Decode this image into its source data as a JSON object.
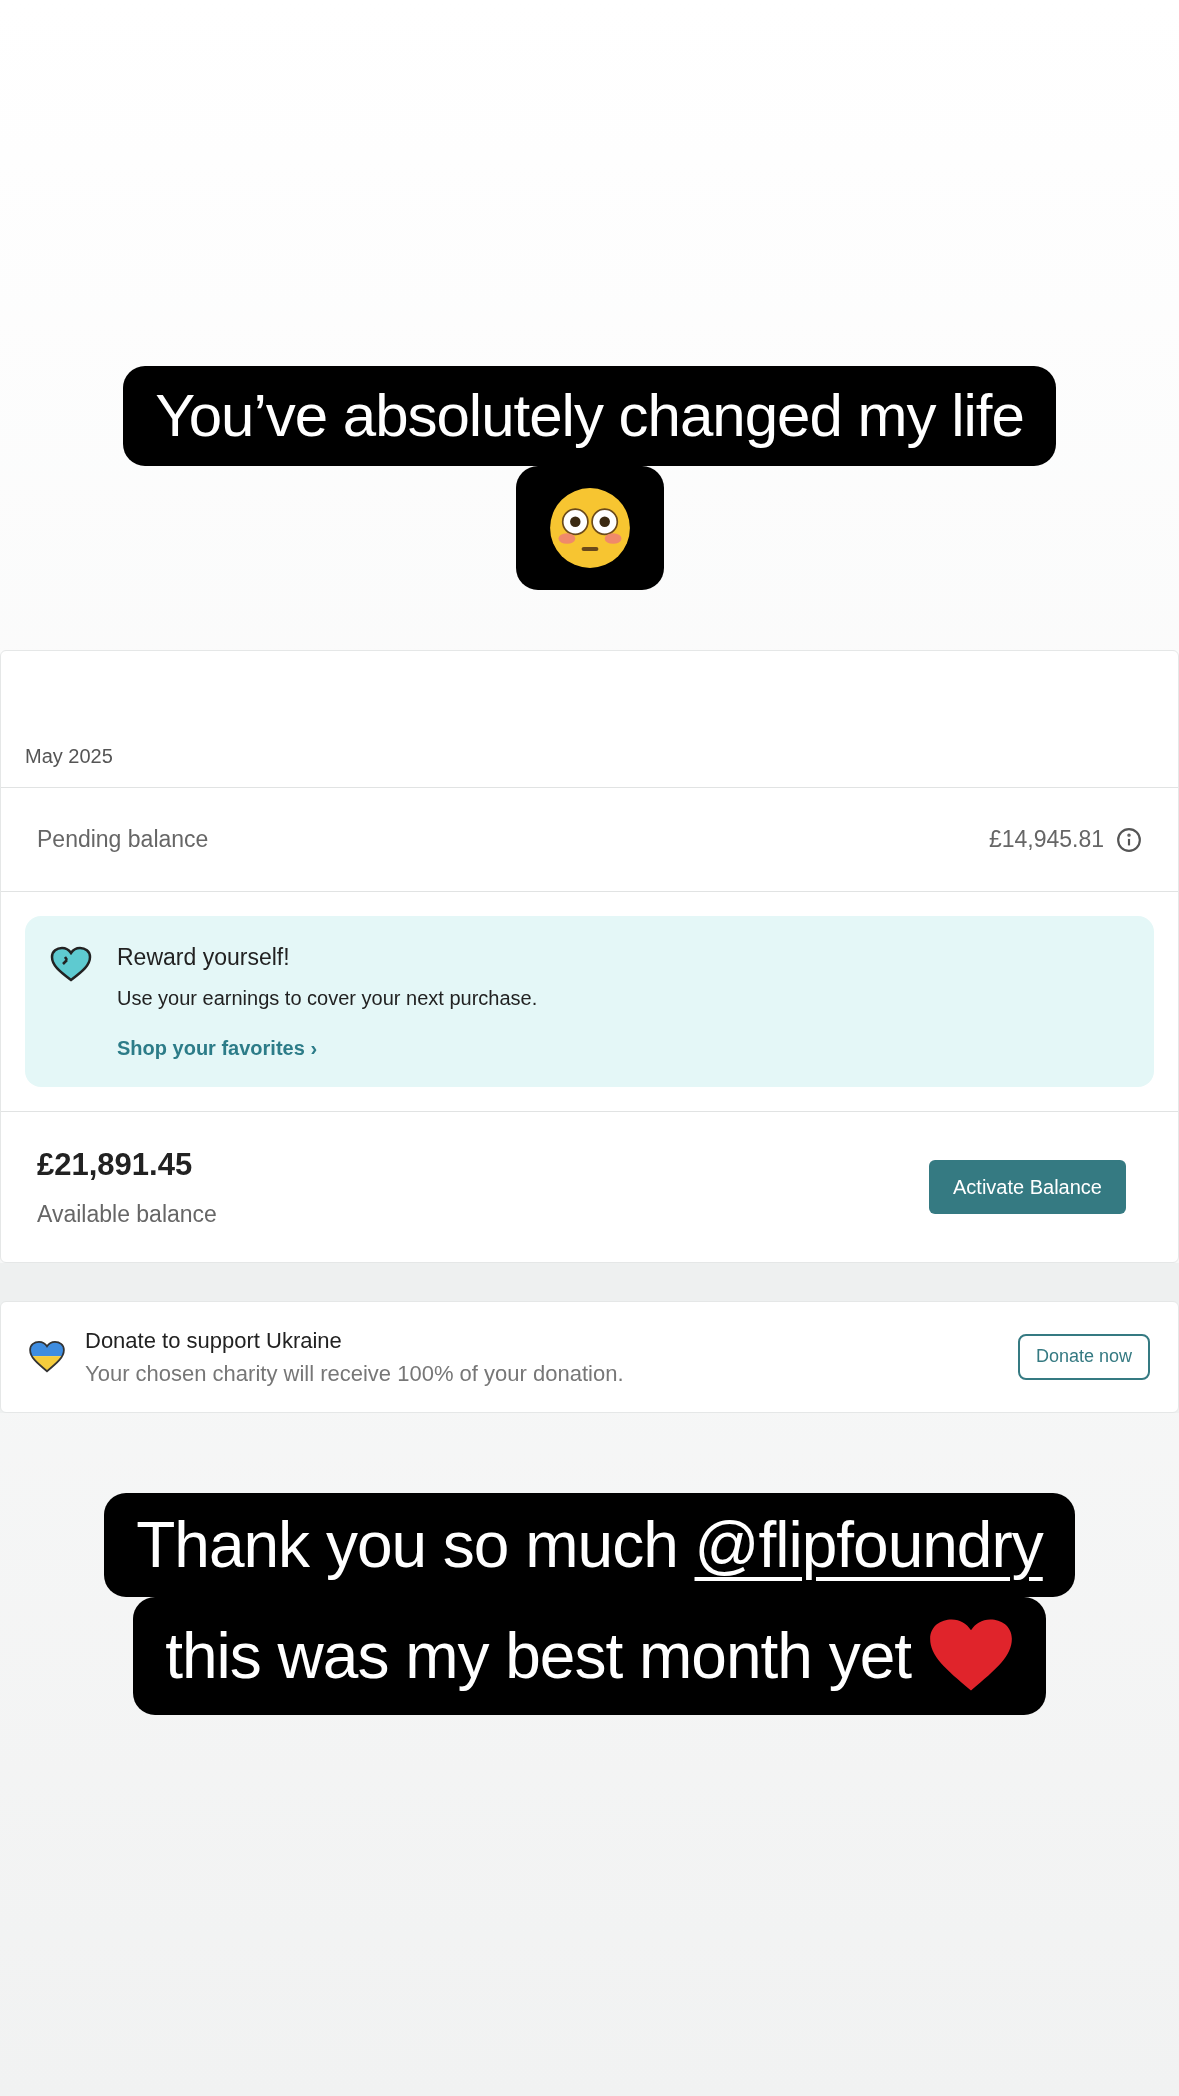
{
  "top_caption": {
    "lines": [
      [
        {
          "kind": "text",
          "text": "You’ve absolutely changed my life"
        }
      ],
      [
        {
          "kind": "flushed"
        }
      ]
    ]
  },
  "balance_card": {
    "month": "May 2025",
    "pending_label": "Pending balance",
    "pending_amount": "£14,945.81",
    "reward": {
      "title": "Reward yourself!",
      "body": "Use your earnings to cover your next purchase.",
      "link": "Shop your favorites",
      "link_chevron": "›"
    },
    "available_amount": "£21,891.45",
    "available_label": "Available balance",
    "activate_button": "Activate Balance"
  },
  "donate_card": {
    "title": "Donate to support Ukraine",
    "body": "Your chosen charity will receive 100% of your donation.",
    "button": "Donate now"
  },
  "bottom_caption": {
    "lines": [
      [
        {
          "kind": "text",
          "text": "Thank you so much "
        },
        {
          "kind": "mention",
          "text": "@flipfoundry"
        }
      ],
      [
        {
          "kind": "text",
          "text": "this was my best month yet "
        },
        {
          "kind": "heart"
        }
      ]
    ]
  }
}
